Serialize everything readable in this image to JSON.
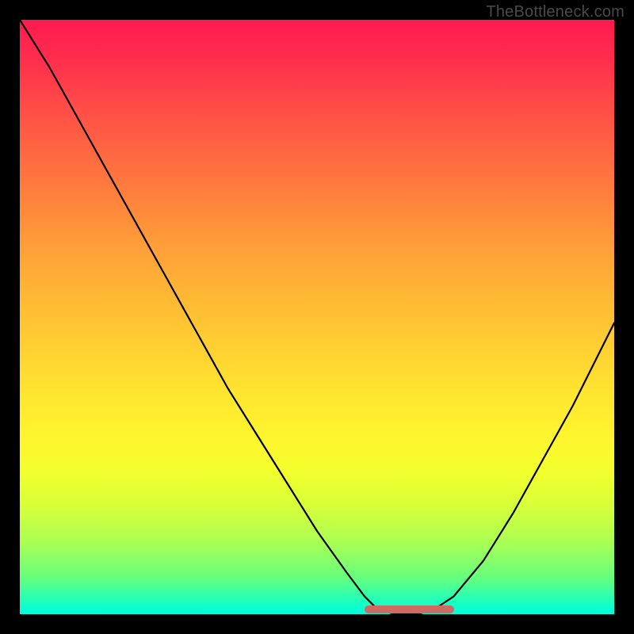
{
  "watermark": "TheBottleneck.com",
  "chart_data": {
    "type": "line",
    "title": "",
    "xlabel": "",
    "ylabel": "",
    "xlim": [
      0,
      100
    ],
    "ylim": [
      0,
      100
    ],
    "grid": false,
    "legend": false,
    "series": [
      {
        "name": "curve",
        "x": [
          0,
          5,
          10,
          15,
          20,
          25,
          30,
          35,
          40,
          45,
          50,
          55,
          58,
          60,
          63,
          67,
          70,
          73,
          78,
          83,
          88,
          93,
          97,
          100
        ],
        "values": [
          100,
          92,
          83,
          74,
          65,
          56,
          47,
          38,
          30,
          22,
          14,
          7,
          3,
          1,
          0,
          0,
          1,
          3,
          9,
          17,
          26,
          35,
          43,
          49
        ]
      }
    ],
    "floor_segment": {
      "x_start": 58,
      "x_end": 73,
      "y": 0.8
    },
    "background_gradient": {
      "orientation": "vertical",
      "stops": [
        {
          "pos": 0.0,
          "color": "#ff1a4f"
        },
        {
          "pos": 0.3,
          "color": "#ff823c"
        },
        {
          "pos": 0.62,
          "color": "#ffe330"
        },
        {
          "pos": 0.88,
          "color": "#a8ff54"
        },
        {
          "pos": 1.0,
          "color": "#00ffe0"
        }
      ]
    }
  }
}
